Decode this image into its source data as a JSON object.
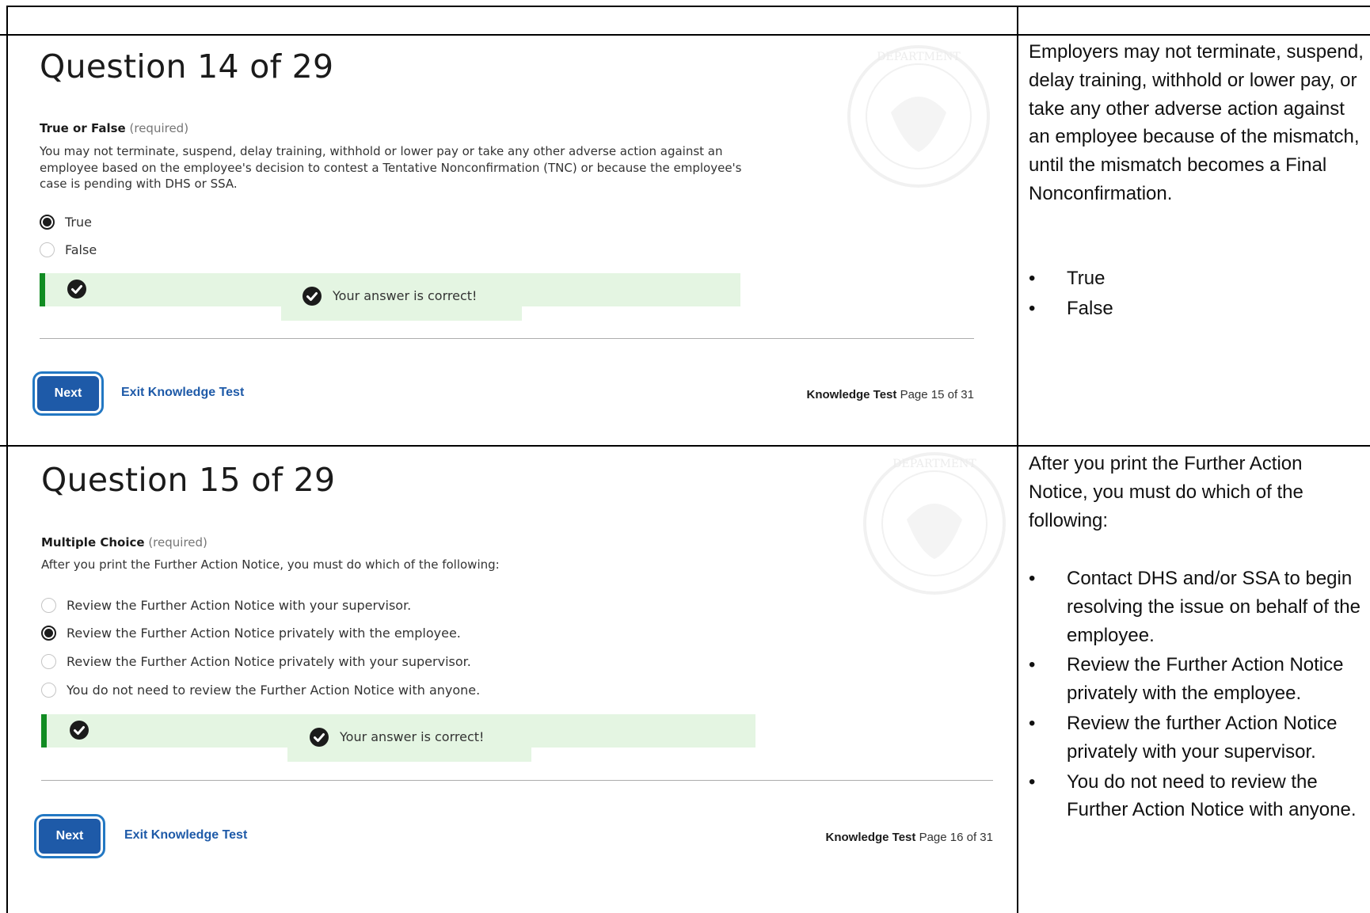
{
  "questions": [
    {
      "title": "Question 14 of 29",
      "type_label": "True or False",
      "required_label": "(required)",
      "prompt": "You may not terminate, suspend, delay training, withhold or lower pay or take any other adverse action against an employee based on the employee's decision to contest a Tentative Nonconfirmation (TNC) or because the employee's case is pending with DHS or SSA.",
      "options": [
        {
          "label": "True",
          "selected": true
        },
        {
          "label": "False",
          "selected": false
        }
      ],
      "feedback": "Your answer is correct!",
      "next_label": "Next",
      "exit_label": "Exit Knowledge Test",
      "page_label": "Knowledge Test",
      "page_value": "Page 15 of 31"
    },
    {
      "title": "Question 15 of 29",
      "type_label": "Multiple Choice",
      "required_label": "(required)",
      "prompt": "After you print the Further Action Notice, you must do which of the following:",
      "options": [
        {
          "label": "Review the Further Action Notice with your supervisor.",
          "selected": false
        },
        {
          "label": "Review the Further Action Notice privately with the employee.",
          "selected": true
        },
        {
          "label": "Review the Further Action Notice privately with your supervisor.",
          "selected": false
        },
        {
          "label": "You do not need to review the Further Action Notice with anyone.",
          "selected": false
        }
      ],
      "feedback": "Your answer is correct!",
      "next_label": "Next",
      "exit_label": "Exit Knowledge Test",
      "page_label": "Knowledge Test",
      "page_value": "Page 16 of 31"
    }
  ],
  "side": [
    {
      "text": "Employers may not terminate, suspend, delay training, withhold or lower pay, or take any other adverse action against an employee because of the mismatch, until the mismatch becomes a Final Nonconfirmation.",
      "bullets": [
        "True",
        "False"
      ]
    },
    {
      "text": "After you print the Further Action Notice, you must do which of the following:",
      "bullets": [
        "Contact DHS and/or SSA to begin resolving the issue on behalf of the employee.",
        "Review the Further Action Notice privately with the employee.",
        "Review the further Action Notice privately with your supervisor.",
        "You do not need to review the Further Action Notice with anyone."
      ]
    }
  ]
}
